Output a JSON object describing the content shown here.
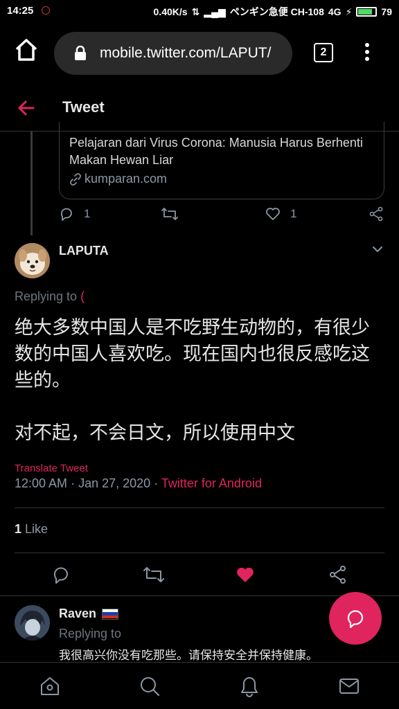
{
  "status_bar": {
    "time": "14:25",
    "speed": "0.40K/s",
    "carrier": "ペンギン急便 CH-108",
    "network": "4G",
    "battery": "79"
  },
  "browser": {
    "url": "mobile.twitter.com/LAPUT/",
    "tab_count": "2"
  },
  "header": {
    "title": "Tweet"
  },
  "quoted_card": {
    "title": "Pelajaran dari Virus Corona: Manusia Harus Berhenti Makan Hewan Liar",
    "domain": "kumparan.com"
  },
  "prev_tweet_actions": {
    "reply_count": "1",
    "like_count": "1"
  },
  "tweet": {
    "author": "LAPUTA",
    "replying_label": "Replying to",
    "replying_mention": "(",
    "text": "绝大多数中国人是不吃野生动物的，有很少数的中国人喜欢吃。现在国内也很反感吃这些的。\n\n对不起，不会日文，所以使用中文",
    "translate_label": "Translate Tweet",
    "time": "12:00 AM",
    "date": "Jan 27, 2020",
    "separator": "·",
    "source": "Twitter for Android",
    "like_count": "1",
    "like_label": "Like",
    "liked": true,
    "like_color": "#e0245e"
  },
  "reply": {
    "author": "Raven",
    "flag": "russia-flag",
    "replying_label": "Replying to",
    "text": "我很高兴你没有吃那些。请保持安全并保持健康。"
  },
  "bottom_nav": {
    "items": [
      "home-icon",
      "search-icon",
      "notifications-icon",
      "messages-icon"
    ]
  },
  "colors": {
    "accent": "#e0245e",
    "background": "#000000",
    "secondary_text": "#8b98a5"
  }
}
